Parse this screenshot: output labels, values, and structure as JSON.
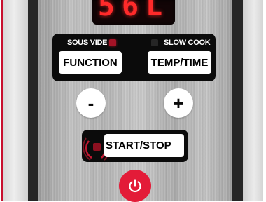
{
  "display": {
    "readout": "56L",
    "color": "#ff2a2a"
  },
  "modes": {
    "sous_vide_label": "SOUS VIDE",
    "slow_cook_label": "SLOW COOK",
    "sous_vide_indicator_color": "#a31326",
    "slow_cook_indicator_color": "#262626",
    "function_button_label": "FUNCTION",
    "temp_time_button_label": "TEMP/TIME"
  },
  "adjust": {
    "decrease_label": "-",
    "increase_label": "+"
  },
  "start_stop": {
    "label": "START/STOP",
    "indicator_color": "#8c1020"
  },
  "power": {
    "icon": "power-icon",
    "color": "#e31b38"
  },
  "accent_color": "#c8102e"
}
